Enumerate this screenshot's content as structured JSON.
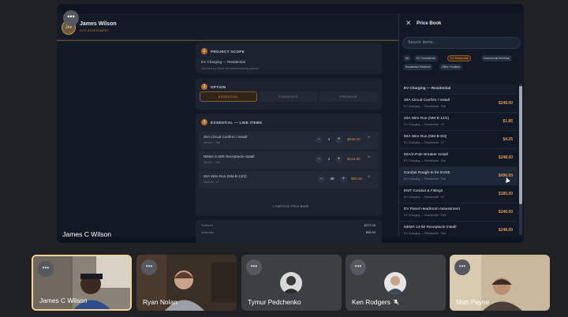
{
  "header": {
    "initials": "JW",
    "user_name": "James Wilson",
    "subtitle": "SITE ASSESSMENT",
    "menu": "•••"
  },
  "scope": {
    "number": "1",
    "title": "PROJECT SCOPE",
    "value": "EV Charging — Residential",
    "sub": "Selected by Client info before building options"
  },
  "option": {
    "number": "2",
    "title": "OPTION",
    "tiers": [
      "ESSENTIAL",
      "STANDARD",
      "PREMIUM"
    ],
    "active_tier": "ESSENTIAL"
  },
  "line_items": {
    "number": "3",
    "title": "ESSENTIAL — LINE ITEMS",
    "items": [
      {
        "name": "20A Circuit Confirm / Install",
        "sub": "Service · Flat",
        "qty": "1",
        "price": "$248.00"
      },
      {
        "name": "NEMA 5-20R Receptacle Install",
        "sub": "Service · Flat",
        "qty": "1",
        "price": "$124.00"
      },
      {
        "name": "20A Wire Run (NM-B 12/2)",
        "sub": "Material · LF",
        "qty": "30",
        "price": "$55.50"
      }
    ],
    "add_label": "+ Add from Price Book"
  },
  "totals": {
    "subtotal_label": "Subtotal",
    "subtotal_value": "$372.00",
    "second_label": "Materials",
    "second_value": "$55.50"
  },
  "price_book": {
    "title": "Price Book",
    "close": "✕",
    "search_placeholder": "Search items...",
    "chips": [
      "All",
      "EV Commercial",
      "EV Residential",
      "Commercial Electrical",
      "Residential Electrical",
      "Office Furniture"
    ],
    "active_chip": "EV Residential",
    "group": "EV Charging — Residential",
    "items": [
      {
        "name": "20A Circuit Confirm / Install",
        "sub": "EV Charging — Residential · Flat",
        "price": "$248.00"
      },
      {
        "name": "20A Wire Run (NM-B 12/2)",
        "sub": "EV Charging — Residential · LF",
        "price": "$1.85"
      },
      {
        "name": "50A Wire Run (NM-B 6/3)",
        "sub": "EV Charging — Residential · LF",
        "price": "$4.25"
      },
      {
        "name": "50A/2-Pole Breaker Install",
        "sub": "EV Charging — Residential · Flat",
        "price": "$248.00"
      },
      {
        "name": "Conduit Rough-In for EVSE",
        "sub": "EV Charging — Residential · Flat",
        "price": "$496.00"
      },
      {
        "name": "EMT Conduit & Fittings",
        "sub": "EV Charging — Residential · LF",
        "price": "$185.00"
      },
      {
        "name": "EV Panel Headroom Assessment",
        "sub": "EV Charging — Residential · Flat",
        "price": "$248.00"
      },
      {
        "name": "NEMA 14-50 Receptacle Install",
        "sub": "EV Charging — Residential · Flat",
        "price": "$248.00"
      }
    ]
  },
  "presenter_name": "James C Wilson",
  "participants": [
    {
      "name": "James C Wilson",
      "speaking": true
    },
    {
      "name": "Ryan Nolan",
      "speaking": false
    },
    {
      "name": "Tymur Pedchenko",
      "speaking": false
    },
    {
      "name": "Ken Rodgers",
      "speaking": false,
      "muted": true
    },
    {
      "name": "Matt Payne",
      "speaking": false
    }
  ],
  "colors": {
    "accent": "#d98a3e",
    "background": "#202124",
    "app_bg": "#121925",
    "speaker_border": "#f5d29a"
  }
}
